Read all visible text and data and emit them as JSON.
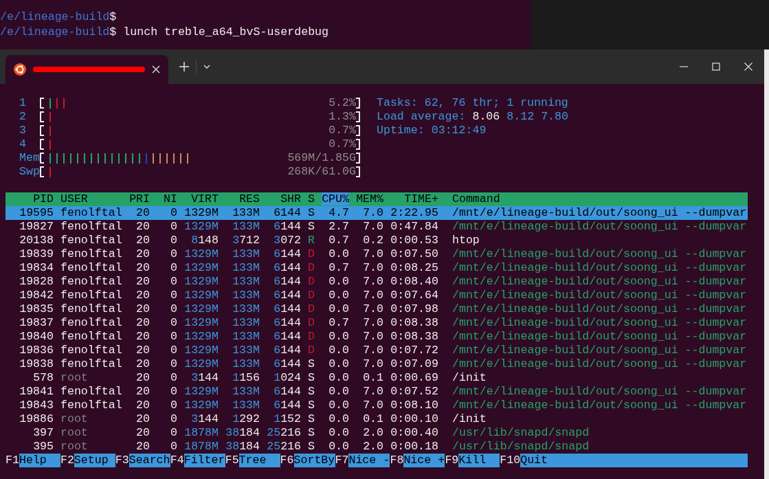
{
  "background_terminal": {
    "lines": [
      {
        "path": "/e/lineage-build",
        "prompt": "$"
      },
      {
        "path": "/e/lineage-build",
        "prompt": "$",
        "command": "lunch treble_a64_bvS-userdebug"
      }
    ]
  },
  "tab": {
    "selected": true,
    "title_redacted": true
  },
  "meters": [
    {
      "label": "1",
      "ticks": [
        {
          "color": "#26a269"
        },
        {
          "color": "#c01c28"
        },
        {
          "color": "#c01c28"
        }
      ],
      "value": "5.2%"
    },
    {
      "label": "2",
      "ticks": [
        {
          "color": "#c01c28"
        }
      ],
      "value": "1.3%"
    },
    {
      "label": "3",
      "ticks": [
        {
          "color": "#c01c28"
        }
      ],
      "value": "0.7%"
    },
    {
      "label": "4",
      "ticks": [
        {
          "color": "#c01c28"
        }
      ],
      "value": "0.7%"
    },
    {
      "label": "Mem",
      "ticks": [
        {
          "color": "#26a269"
        },
        {
          "color": "#26a269"
        },
        {
          "color": "#26a269"
        },
        {
          "color": "#26a269"
        },
        {
          "color": "#26a269"
        },
        {
          "color": "#26a269"
        },
        {
          "color": "#26a269"
        },
        {
          "color": "#26a269"
        },
        {
          "color": "#26a269"
        },
        {
          "color": "#26a269"
        },
        {
          "color": "#26a269"
        },
        {
          "color": "#26a269"
        },
        {
          "color": "#26a269"
        },
        {
          "color": "#26a269"
        },
        {
          "color": "#1c3fe0"
        },
        {
          "color": "#c48a5c"
        },
        {
          "color": "#c48a5c"
        },
        {
          "color": "#c48a5c"
        },
        {
          "color": "#c48a5c"
        },
        {
          "color": "#c48a5c"
        },
        {
          "color": "#c48a5c"
        }
      ],
      "value": "569M/1.85G"
    },
    {
      "label": "Swp",
      "ticks": [
        {
          "color": "#c01c28"
        }
      ],
      "value": "268K/61.0G"
    }
  ],
  "summary": {
    "tasks": "Tasks: 62, 76 thr; 1 running",
    "load_label": "Load average:",
    "load_values": [
      "8.06",
      "8.12",
      "7.80"
    ],
    "uptime_label": "Uptime:",
    "uptime": "03:12:49"
  },
  "columns": [
    {
      "label": "PID",
      "sorted": false
    },
    {
      "label": "USER",
      "sorted": false
    },
    {
      "label": "PRI",
      "sorted": false
    },
    {
      "label": "NI",
      "sorted": false
    },
    {
      "label": "VIRT",
      "sorted": false
    },
    {
      "label": "RES",
      "sorted": false
    },
    {
      "label": "SHR",
      "sorted": false
    },
    {
      "label": "S",
      "sorted": false
    },
    {
      "label": "CPU%",
      "sorted": true
    },
    {
      "label": "MEM%",
      "sorted": false
    },
    {
      "label": "TIME+",
      "sorted": false
    },
    {
      "label": "Command",
      "sorted": false
    }
  ],
  "processes": [
    {
      "pid": "19595",
      "user": "fenolftal",
      "pri": "20",
      "ni": "0",
      "virt": "1329M",
      "res": "133M",
      "shr": "6144",
      "state": "S",
      "cpu": "4.7",
      "mem": "7.0",
      "time": "2:22.95",
      "command": "/mnt/e/lineage-build/out/soong_ui --dumpvar",
      "selected": true
    },
    {
      "pid": "19827",
      "user": "fenolftal",
      "system_user": false,
      "pri": "20",
      "ni": "0",
      "virt": "1329M",
      "res": "133M",
      "shr": "6144",
      "state": "S",
      "kind": "sleeping",
      "cpu": "2.7",
      "mem": "7.0",
      "time": "0:47.84",
      "command": "/mnt/e/lineage-build/out/soong_ui --dumpvar",
      "thread": true,
      "selected": false
    },
    {
      "pid": "20138",
      "user": "fenolftal",
      "system_user": false,
      "pri": "20",
      "ni": "0",
      "virt": "8148",
      "res": "3712",
      "shr": "3072",
      "state": "R",
      "kind": "running",
      "cpu": "0.7",
      "mem": "0.2",
      "time": "0:00.53",
      "command": "htop",
      "thread": false,
      "selected": false
    },
    {
      "pid": "19839",
      "user": "fenolftal",
      "system_user": false,
      "pri": "20",
      "ni": "0",
      "virt": "1329M",
      "res": "133M",
      "shr": "6144",
      "state": "D",
      "kind": "waiting",
      "cpu": "0.0",
      "mem": "7.0",
      "time": "0:07.50",
      "command": "/mnt/e/lineage-build/out/soong_ui --dumpvar",
      "thread": true,
      "selected": false
    },
    {
      "pid": "19834",
      "user": "fenolftal",
      "system_user": false,
      "pri": "20",
      "ni": "0",
      "virt": "1329M",
      "res": "133M",
      "shr": "6144",
      "state": "D",
      "kind": "waiting",
      "cpu": "0.7",
      "mem": "7.0",
      "time": "0:08.25",
      "command": "/mnt/e/lineage-build/out/soong_ui --dumpvar",
      "thread": true,
      "selected": false
    },
    {
      "pid": "19828",
      "user": "fenolftal",
      "system_user": false,
      "pri": "20",
      "ni": "0",
      "virt": "1329M",
      "res": "133M",
      "shr": "6144",
      "state": "D",
      "kind": "waiting",
      "cpu": "0.0",
      "mem": "7.0",
      "time": "0:08.40",
      "command": "/mnt/e/lineage-build/out/soong_ui --dumpvar",
      "thread": true,
      "selected": false
    },
    {
      "pid": "19842",
      "user": "fenolftal",
      "system_user": false,
      "pri": "20",
      "ni": "0",
      "virt": "1329M",
      "res": "133M",
      "shr": "6144",
      "state": "D",
      "kind": "waiting",
      "cpu": "0.0",
      "mem": "7.0",
      "time": "0:07.64",
      "command": "/mnt/e/lineage-build/out/soong_ui --dumpvar",
      "thread": true,
      "selected": false
    },
    {
      "pid": "19835",
      "user": "fenolftal",
      "system_user": false,
      "pri": "20",
      "ni": "0",
      "virt": "1329M",
      "res": "133M",
      "shr": "6144",
      "state": "D",
      "kind": "waiting",
      "cpu": "0.0",
      "mem": "7.0",
      "time": "0:07.98",
      "command": "/mnt/e/lineage-build/out/soong_ui --dumpvar",
      "thread": true,
      "selected": false
    },
    {
      "pid": "19837",
      "user": "fenolftal",
      "system_user": false,
      "pri": "20",
      "ni": "0",
      "virt": "1329M",
      "res": "133M",
      "shr": "6144",
      "state": "D",
      "kind": "waiting",
      "cpu": "0.7",
      "mem": "7.0",
      "time": "0:08.38",
      "command": "/mnt/e/lineage-build/out/soong_ui --dumpvar",
      "thread": true,
      "selected": false
    },
    {
      "pid": "19840",
      "user": "fenolftal",
      "system_user": false,
      "pri": "20",
      "ni": "0",
      "virt": "1329M",
      "res": "133M",
      "shr": "6144",
      "state": "D",
      "kind": "waiting",
      "cpu": "0.0",
      "mem": "7.0",
      "time": "0:08.38",
      "command": "/mnt/e/lineage-build/out/soong_ui --dumpvar",
      "thread": true,
      "selected": false
    },
    {
      "pid": "19836",
      "user": "fenolftal",
      "system_user": false,
      "pri": "20",
      "ni": "0",
      "virt": "1329M",
      "res": "133M",
      "shr": "6144",
      "state": "D",
      "kind": "waiting",
      "cpu": "0.0",
      "mem": "7.0",
      "time": "0:07.72",
      "command": "/mnt/e/lineage-build/out/soong_ui --dumpvar",
      "thread": true,
      "selected": false
    },
    {
      "pid": "19838",
      "user": "fenolftal",
      "system_user": false,
      "pri": "20",
      "ni": "0",
      "virt": "1329M",
      "res": "133M",
      "shr": "6144",
      "state": "S",
      "kind": "sleeping",
      "cpu": "0.0",
      "mem": "7.0",
      "time": "0:07.09",
      "command": "/mnt/e/lineage-build/out/soong_ui --dumpvar",
      "thread": true,
      "selected": false
    },
    {
      "pid": "578",
      "user": "root",
      "system_user": true,
      "pri": "20",
      "ni": "0",
      "virt": "3144",
      "res": "1156",
      "shr": "1024",
      "state": "S",
      "kind": "sleeping",
      "cpu": "0.0",
      "mem": "0.1",
      "time": "0:00.69",
      "command": "/init",
      "thread": false,
      "selected": false
    },
    {
      "pid": "19841",
      "user": "fenolftal",
      "system_user": false,
      "pri": "20",
      "ni": "0",
      "virt": "1329M",
      "res": "133M",
      "shr": "6144",
      "state": "S",
      "kind": "sleeping",
      "cpu": "0.0",
      "mem": "7.0",
      "time": "0:07.52",
      "command": "/mnt/e/lineage-build/out/soong_ui --dumpvar",
      "thread": true,
      "selected": false
    },
    {
      "pid": "19843",
      "user": "fenolftal",
      "system_user": false,
      "pri": "20",
      "ni": "0",
      "virt": "1329M",
      "res": "133M",
      "shr": "6144",
      "state": "S",
      "kind": "sleeping",
      "cpu": "0.0",
      "mem": "7.0",
      "time": "0:08.10",
      "command": "/mnt/e/lineage-build/out/soong_ui --dumpvar",
      "thread": true,
      "selected": false
    },
    {
      "pid": "19886",
      "user": "root",
      "system_user": true,
      "pri": "20",
      "ni": "0",
      "virt": "3144",
      "res": "1292",
      "shr": "1152",
      "state": "S",
      "kind": "sleeping",
      "cpu": "0.0",
      "mem": "0.1",
      "time": "0:00.10",
      "command": "/init",
      "thread": false,
      "selected": false
    },
    {
      "pid": "397",
      "user": "root",
      "system_user": true,
      "pri": "20",
      "ni": "0",
      "virt": "1878M",
      "res": "38184",
      "shr": "25216",
      "state": "S",
      "kind": "sleeping",
      "cpu": "0.0",
      "mem": "2.0",
      "time": "0:00.40",
      "command": "/usr/lib/snapd/snapd",
      "thread": true,
      "selected": false
    },
    {
      "pid": "395",
      "user": "root",
      "system_user": true,
      "pri": "20",
      "ni": "0",
      "virt": "1878M",
      "res": "38184",
      "shr": "25216",
      "state": "S",
      "kind": "sleeping",
      "cpu": "0.0",
      "mem": "2.0",
      "time": "0:00.18",
      "command": "/usr/lib/snapd/snapd",
      "thread": true,
      "selected": false
    }
  ],
  "function_keys": [
    {
      "key": "F1",
      "label": "Help"
    },
    {
      "key": "F2",
      "label": "Setup"
    },
    {
      "key": "F3",
      "label": "Search"
    },
    {
      "key": "F4",
      "label": "Filter"
    },
    {
      "key": "F5",
      "label": "Tree"
    },
    {
      "key": "F6",
      "label": "SortBy"
    },
    {
      "key": "F7",
      "label": "Nice -"
    },
    {
      "key": "F8",
      "label": "Nice +"
    },
    {
      "key": "F9",
      "label": "Kill"
    },
    {
      "key": "F10",
      "label": "Quit"
    }
  ]
}
